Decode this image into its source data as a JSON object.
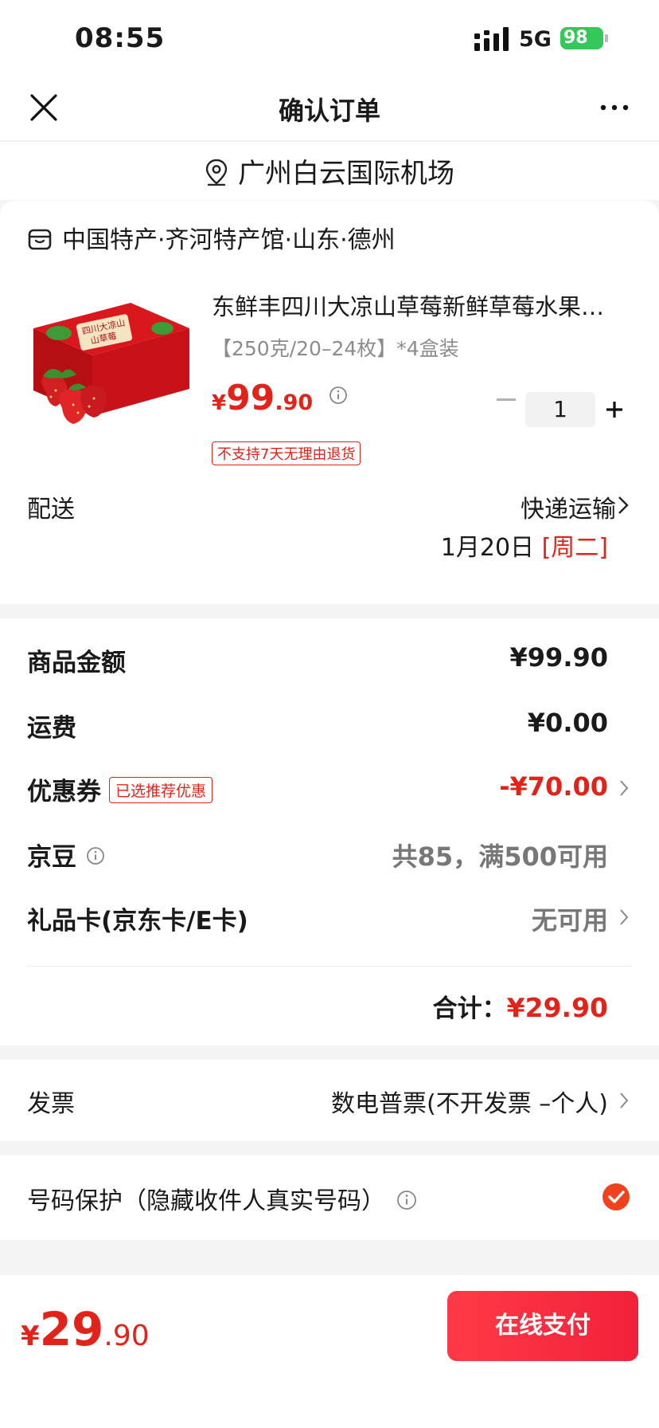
{
  "status_bar": {
    "time": "08:55",
    "network": "5G",
    "battery": "98"
  },
  "nav": {
    "title": "确认订单"
  },
  "address": {
    "text": "广州白云国际机场"
  },
  "shop": {
    "name": "中国特产·齐河特产馆·山东·德州"
  },
  "product": {
    "title": "东鲜丰四川大凉山草莓新鲜草莓水果…",
    "spec": "【250克/20–24枚】*4盒装",
    "price_symbol": "¥",
    "price_int": "99",
    "price_dec": ".90",
    "quantity": "1",
    "return_policy": "不支持7天无理由退货",
    "image_text": "四川大凉山草莓"
  },
  "delivery": {
    "label": "配送",
    "method": "快递运输",
    "date": "1月20日",
    "weekday": "[周二]"
  },
  "amounts": {
    "goods_label": "商品金额",
    "goods_value": "¥99.90",
    "shipping_label": "运费",
    "shipping_value": "¥0.00",
    "coupon_label": "优惠券",
    "coupon_badge": "已选推荐优惠",
    "coupon_value": "-¥70.00",
    "beans_label": "京豆",
    "beans_value": "共85，满500可用",
    "giftcard_label": "礼品卡(京东卡/E卡)",
    "giftcard_value": "无可用",
    "total_label": "合计：",
    "total_value": "¥29.90"
  },
  "invoice": {
    "label": "发票",
    "value": "数电普票(不开发票 –个人)"
  },
  "protection": {
    "label": "号码保护（隐藏收件人真实号码）",
    "checked": true
  },
  "footer": {
    "price_symbol": "¥",
    "price_int": "29",
    "price_dec": ".90",
    "pay_label": "在线支付"
  },
  "colors": {
    "accent": "#e2231a",
    "battery": "#34c759",
    "pay_button": "#f2213a"
  },
  "icons": [
    "close-icon",
    "more-icon",
    "location-icon",
    "shop-icon",
    "info-icon",
    "chevron-right-icon",
    "check-icon",
    "signal-icon"
  ]
}
